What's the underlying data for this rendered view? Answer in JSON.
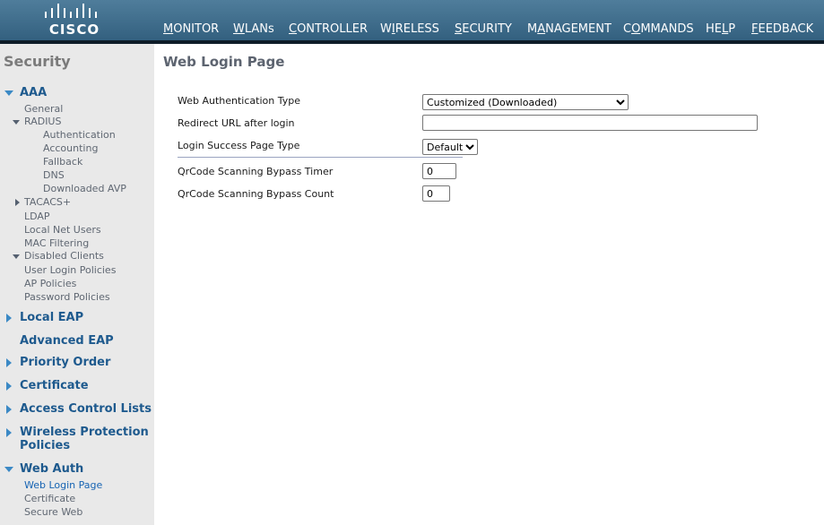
{
  "logo": {
    "text": "CISCO"
  },
  "nav": [
    {
      "label": "MONITOR",
      "ul": "M",
      "rest": "ONITOR"
    },
    {
      "label": "WLANs",
      "ul": "W",
      "rest": "LANs"
    },
    {
      "label": "CONTROLLER",
      "ul": "C",
      "rest": "ONTROLLER"
    },
    {
      "label": "WIRELESS",
      "pre": "W",
      "ul": "I",
      "rest": "RELESS"
    },
    {
      "label": "SECURITY",
      "ul": "S",
      "rest": "ECURITY"
    },
    {
      "label": "MANAGEMENT",
      "pre": "M",
      "ul": "A",
      "rest": "NAGEMENT"
    },
    {
      "label": "COMMANDS",
      "pre": "C",
      "ul": "O",
      "rest": "MMANDS"
    },
    {
      "label": "HELP",
      "pre": "HE",
      "ul": "L",
      "rest": "P"
    },
    {
      "label": "FEEDBACK",
      "ul": "F",
      "rest": "EEDBACK"
    }
  ],
  "sidebar": {
    "title": "Security",
    "aaa": {
      "label": "AAA",
      "general": "General",
      "radius": "RADIUS",
      "radius_items": [
        "Authentication",
        "Accounting",
        "Fallback",
        "DNS",
        "Downloaded AVP"
      ],
      "tacacs": "TACACS+",
      "ldap": "LDAP",
      "local_net_users": "Local Net Users",
      "mac_filtering": "MAC Filtering",
      "disabled_clients": "Disabled Clients",
      "user_login_policies": "User Login Policies",
      "ap_policies": "AP Policies",
      "password_policies": "Password Policies"
    },
    "local_eap": "Local EAP",
    "advanced_eap": "Advanced EAP",
    "priority_order": "Priority Order",
    "certificate": "Certificate",
    "acl": "Access Control Lists",
    "wpp_line1": "Wireless Protection",
    "wpp_line2": "Policies",
    "web_auth": {
      "label": "Web Auth",
      "items": [
        "Web Login Page",
        "Certificate",
        "Secure Web"
      ]
    }
  },
  "main": {
    "title": "Web Login Page",
    "fields": {
      "web_auth_type_label": "Web Authentication Type",
      "web_auth_type_value": "Customized (Downloaded)",
      "redirect_label": "Redirect URL after login",
      "redirect_value": "",
      "success_type_label": "Login Success Page Type",
      "success_type_value": "Default",
      "qr_timer_label": "QrCode Scanning Bypass Timer",
      "qr_timer_value": "0",
      "qr_count_label": "QrCode Scanning Bypass Count",
      "qr_count_value": "0"
    }
  },
  "colors": {
    "header_top": "#4f7d9b",
    "header_bottom": "#33607f",
    "active_tab": "#f7931e",
    "sidebar_bg": "#e9e9e9",
    "link_blue": "#1e5a8e"
  }
}
